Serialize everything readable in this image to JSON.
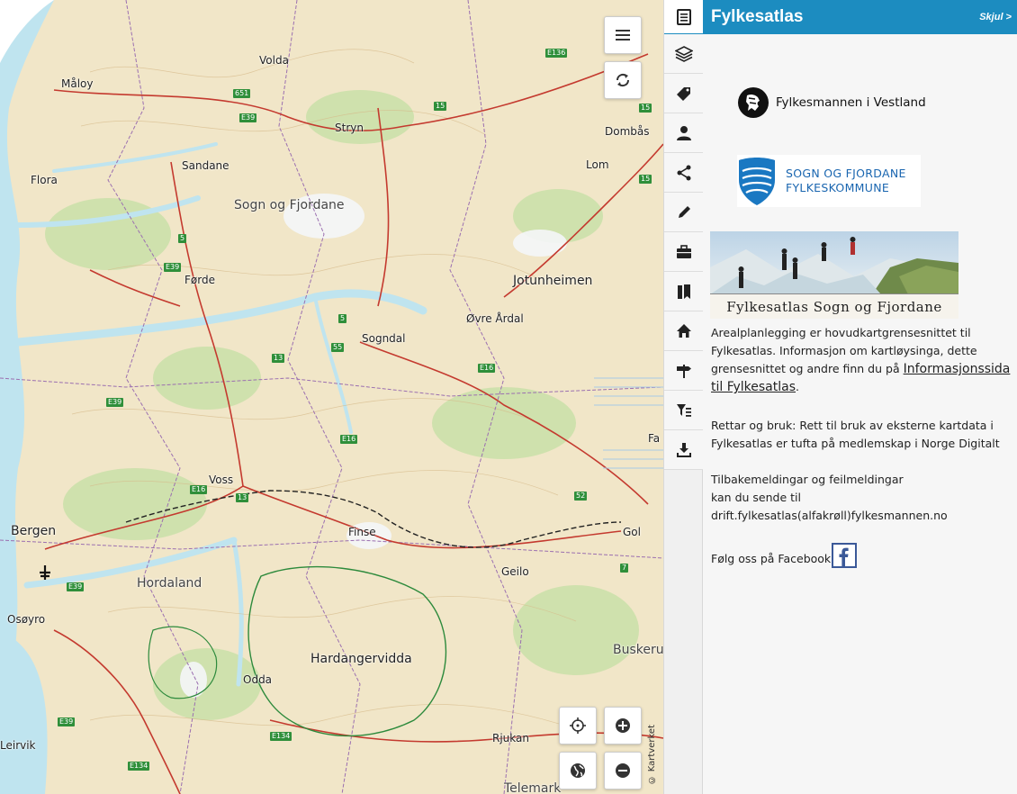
{
  "panel": {
    "title": "Fylkesatlas",
    "hide_label": "Skjul >",
    "logo1_text": "Fylkesmannen i Vestland",
    "logo2_line1": "SOGN OG FJORDANE",
    "logo2_line2": "FYLKESKOMMUNE",
    "banner_caption": "Fylkesatlas Sogn og Fjordane",
    "para1": "Arealplanlegging er hovudkartgrensesnittet til Fylkesatlas. Informasjon om kartløysinga, dette grensesnittet og andre finn du på ",
    "para1_link": "Informasjonssida til Fylkesatlas",
    "para1_end": ".",
    "para2": "Rettar og bruk: Rett til bruk av eksterne kartdata i Fylkesatlas er tufta på medlemskap i Norge Digitalt",
    "para3_l1": "Tilbakemeldingar og feilmeldingar",
    "para3_l2": "kan du sende til",
    "para3_l3": "drift.fylkesatlas(alfakrøll)fylkesmannen.no",
    "para4": "Følg oss på Facebook"
  },
  "tools": [
    {
      "name": "info-icon"
    },
    {
      "name": "layers-icon"
    },
    {
      "name": "tag-icon"
    },
    {
      "name": "user-icon"
    },
    {
      "name": "share-icon"
    },
    {
      "name": "pencil-icon"
    },
    {
      "name": "briefcase-icon"
    },
    {
      "name": "bookmark-icon"
    },
    {
      "name": "home-icon"
    },
    {
      "name": "signpost-icon"
    },
    {
      "name": "filter-icon"
    },
    {
      "name": "download-icon"
    }
  ],
  "map": {
    "attribution": "© Kartverket",
    "places": [
      {
        "label": "Måloy",
        "cls": ""
      },
      {
        "label": "Volda",
        "cls": ""
      },
      {
        "label": "Stryn",
        "cls": ""
      },
      {
        "label": "Dombås",
        "cls": ""
      },
      {
        "label": "Lom",
        "cls": ""
      },
      {
        "label": "Sandane",
        "cls": ""
      },
      {
        "label": "Flora",
        "cls": ""
      },
      {
        "label": "Sogn og Fjordane",
        "cls": "region"
      },
      {
        "label": "Førde",
        "cls": ""
      },
      {
        "label": "Jotunheimen",
        "cls": "large"
      },
      {
        "label": "Øvre Årdal",
        "cls": ""
      },
      {
        "label": "Sogndal",
        "cls": ""
      },
      {
        "label": "Voss",
        "cls": ""
      },
      {
        "label": "Bergen",
        "cls": "large"
      },
      {
        "label": "Finse",
        "cls": ""
      },
      {
        "label": "Gol",
        "cls": ""
      },
      {
        "label": "Geilo",
        "cls": ""
      },
      {
        "label": "Hordaland",
        "cls": "region"
      },
      {
        "label": "Osøyro",
        "cls": ""
      },
      {
        "label": "Hardangervidda",
        "cls": "large"
      },
      {
        "label": "Odda",
        "cls": ""
      },
      {
        "label": "Buskeru",
        "cls": "region"
      },
      {
        "label": "Rjukan",
        "cls": ""
      },
      {
        "label": "Leirvik",
        "cls": ""
      },
      {
        "label": "Fa",
        "cls": ""
      },
      {
        "label": "Telemark",
        "cls": "region"
      }
    ],
    "shields": [
      "E136",
      "651",
      "E39",
      "15",
      "15",
      "5",
      "E39",
      "5",
      "55",
      "13",
      "E16",
      "E39",
      "E16",
      "E16",
      "13",
      "52",
      "E39",
      "7",
      "E39",
      "E134",
      "E134",
      "15"
    ]
  }
}
